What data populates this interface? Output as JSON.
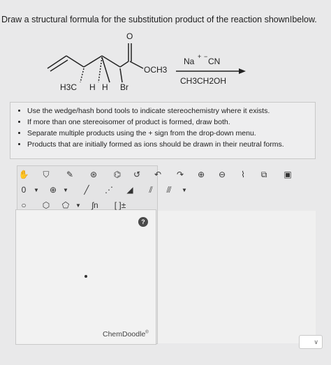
{
  "question": {
    "text": "Draw a structural formula for the substitution product of the reaction shown",
    "cursor": "I",
    "text_end": "below."
  },
  "scheme": {
    "carbonyl_o": "O",
    "och3": "OCH3",
    "h3c": "H3C",
    "h1": "H",
    "h2": "H",
    "br": "Br",
    "reagent": "Na+ −CN",
    "reagent_na": "Na",
    "reagent_plus": "+",
    "reagent_minus": "−",
    "reagent_cn": "CN",
    "solvent": "CH3CH2OH"
  },
  "instructions": {
    "items": [
      "Use the wedge/hash bond tools to indicate stereochemistry where it exists.",
      "If more than one stereoisomer of product is formed, draw both.",
      "Separate multiple products using the + sign from the drop-down menu.",
      "Products that are initially formed as ions should be drawn in their neutral forms."
    ]
  },
  "toolbar": {
    "row1": [
      "hand-icon",
      "lasso-icon",
      "eraser-icon",
      "ring-template-icon",
      "attached-rings-icon",
      "arrows-icon",
      "undo-icon",
      "redo-icon",
      "zoom-in-icon",
      "zoom-out-icon",
      "clean-icon",
      "copy-icon",
      "paste-icon"
    ],
    "charge_label": "0",
    "plus_label": "⊕",
    "bracket_label": "[ ]±",
    "fn_label": "ʃn"
  },
  "editor": {
    "help": "?",
    "brand": "ChemDoodle",
    "brand_mark": "®"
  },
  "select": {
    "caret": "∨"
  }
}
